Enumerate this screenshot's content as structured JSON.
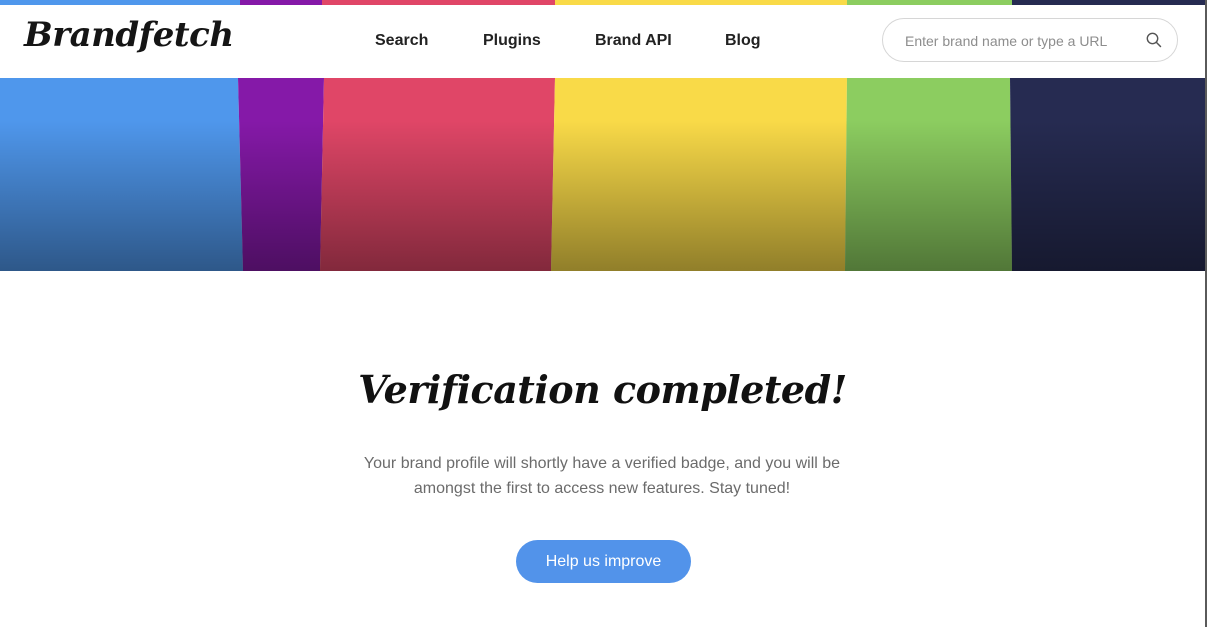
{
  "header": {
    "logo_text": "Brandfetch",
    "nav": [
      {
        "label": "Search"
      },
      {
        "label": "Plugins"
      },
      {
        "label": "Brand API"
      },
      {
        "label": "Blog"
      }
    ],
    "search": {
      "placeholder": "Enter brand name or type a URL",
      "value": "",
      "icon": "search-icon"
    }
  },
  "hero": {
    "stripe_colors": [
      "#4f97ec",
      "#8519a8",
      "#e04667",
      "#f9da48",
      "#8ccd60",
      "#262b51"
    ]
  },
  "main": {
    "heading": "Verification completed!",
    "description": "Your brand profile will shortly have a verified badge, and you will be amongst the first to access new features. Stay tuned!",
    "cta_label": "Help us improve"
  },
  "colors": {
    "accent": "#5293ea",
    "heading": "#111111",
    "body_text": "#6b6b6b"
  }
}
